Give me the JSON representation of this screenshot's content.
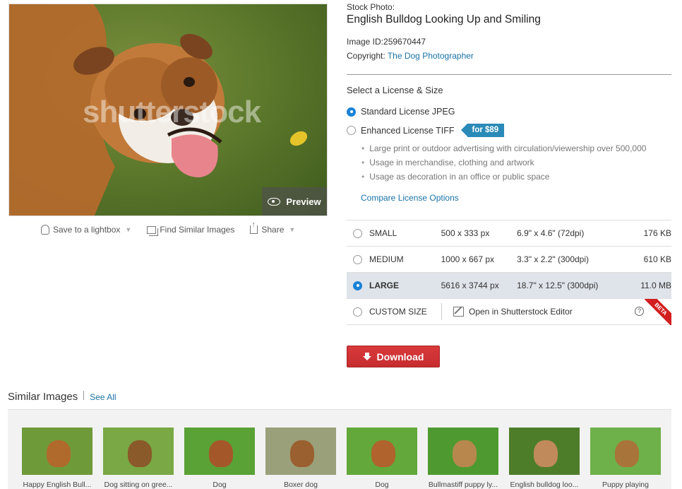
{
  "photo": {
    "watermark": "shutterstock",
    "preview_label": "Preview"
  },
  "photo_actions": {
    "save": "Save to a lightbox",
    "similar": "Find Similar Images",
    "share": "Share"
  },
  "info": {
    "kind": "Stock Photo:",
    "title": "English Bulldog Looking Up and Smiling",
    "image_id_label": "Image ID:",
    "image_id": "259670447",
    "copyright_label": "Copyright:",
    "copyright_owner": "The Dog Photographer"
  },
  "license": {
    "heading": "Select a License & Size",
    "standard": "Standard License JPEG",
    "enhanced": "Enhanced License TIFF",
    "enhanced_price": "for $89",
    "bullets": [
      "Large print or outdoor advertising with circulation/viewership over 500,000",
      "Usage in merchandise, clothing and artwork",
      "Usage as decoration in an office or public space"
    ],
    "compare": "Compare License Options"
  },
  "sizes": [
    {
      "name": "SMALL",
      "px": "500 x 333 px",
      "dim": "6.9\" x 4.6\" (72dpi)",
      "kb": "176 KB"
    },
    {
      "name": "MEDIUM",
      "px": "1000 x 667 px",
      "dim": "3.3\" x 2.2\" (300dpi)",
      "kb": "610 KB"
    },
    {
      "name": "LARGE",
      "px": "5616 x 3744 px",
      "dim": "18.7\" x 12.5\" (300dpi)",
      "kb": "11.0 MB"
    }
  ],
  "custom": {
    "name": "CUSTOM SIZE",
    "editor": "Open in Shutterstock Editor",
    "help": "?",
    "beta": "BETA"
  },
  "download_label": "Download",
  "similar": {
    "title": "Similar Images",
    "see_all": "See All",
    "items": [
      {
        "caption": "Happy English Bull...",
        "bg": "#6f9a3a",
        "dog": "#b06a2c"
      },
      {
        "caption": "Dog sitting on gree...",
        "bg": "#79a845",
        "dog": "#8a5a2a"
      },
      {
        "caption": "Dog",
        "bg": "#5aa236",
        "dog": "#a4582a"
      },
      {
        "caption": "Boxer dog",
        "bg": "#9aa07a",
        "dog": "#9a6030"
      },
      {
        "caption": "Dog",
        "bg": "#62a83a",
        "dog": "#b0632c"
      },
      {
        "caption": "Bullmastiff puppy ly...",
        "bg": "#4f9a30",
        "dog": "#b8874e"
      },
      {
        "caption": "English bulldog loo...",
        "bg": "#4e7d2a",
        "dog": "#c08a5a"
      },
      {
        "caption": "Puppy playing",
        "bg": "#6eb04a",
        "dog": "#a8743a"
      }
    ]
  }
}
